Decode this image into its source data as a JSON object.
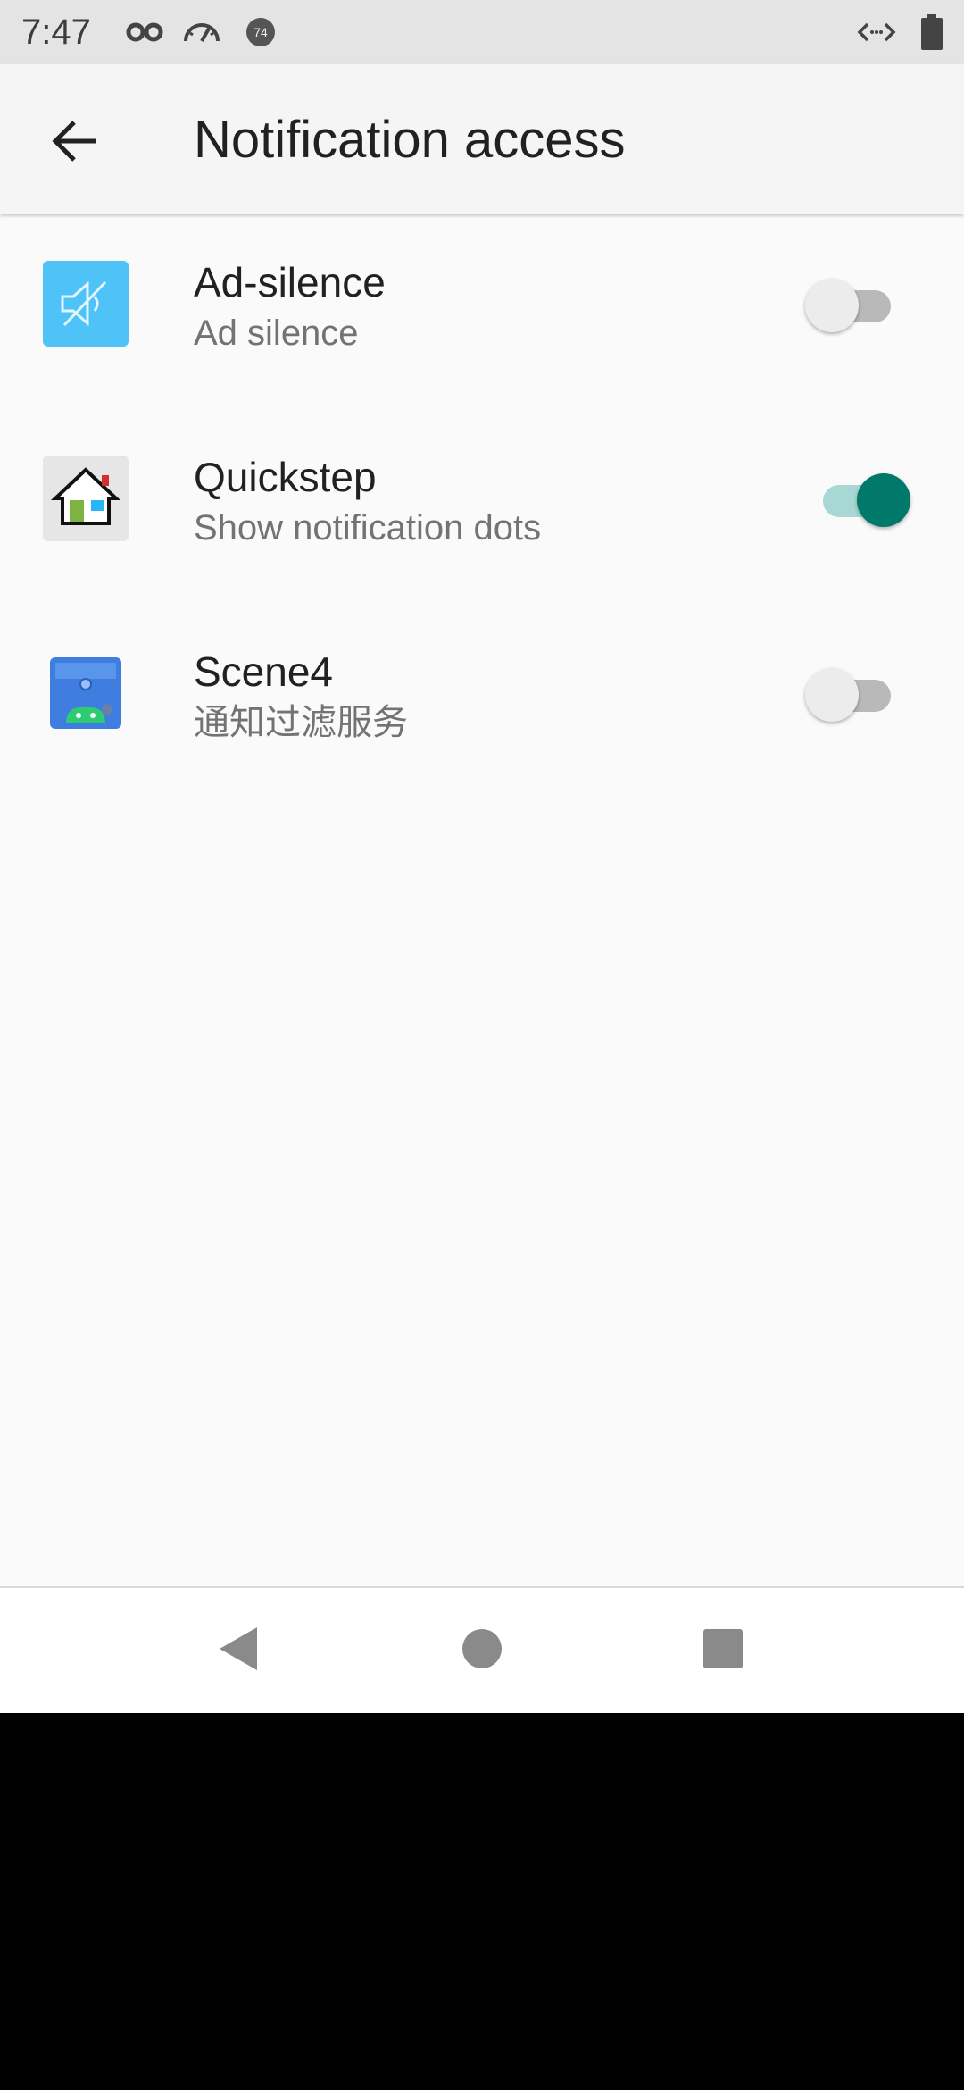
{
  "status_bar": {
    "time": "7:47",
    "left_icons": [
      "incognito-icon",
      "speedometer-icon",
      "circle-badge-icon"
    ],
    "badge_text": "74",
    "right_icons": [
      "code-arrows-icon",
      "battery-icon"
    ]
  },
  "app_bar": {
    "title": "Notification access",
    "back_icon": "arrow-back-icon"
  },
  "items": [
    {
      "title": "Ad-silence",
      "summary": "Ad silence",
      "icon": "muted-speaker-icon",
      "icon_bg": "#4fc3f7",
      "enabled": false
    },
    {
      "title": "Quickstep",
      "summary": "Show notification dots",
      "icon": "house-icon",
      "icon_bg": "#e6e6e6",
      "enabled": true
    },
    {
      "title": "Scene4",
      "summary": "通知过滤服务",
      "icon": "scene-android-icon",
      "icon_bg": "#3f7de0",
      "enabled": false
    }
  ],
  "nav_bar": {
    "back": "triangle-back-icon",
    "home": "circle-home-icon",
    "recents": "square-recents-icon"
  },
  "colors": {
    "accent": "#00796b",
    "accent_track": "#a8d8d3",
    "background": "#fafafa"
  }
}
